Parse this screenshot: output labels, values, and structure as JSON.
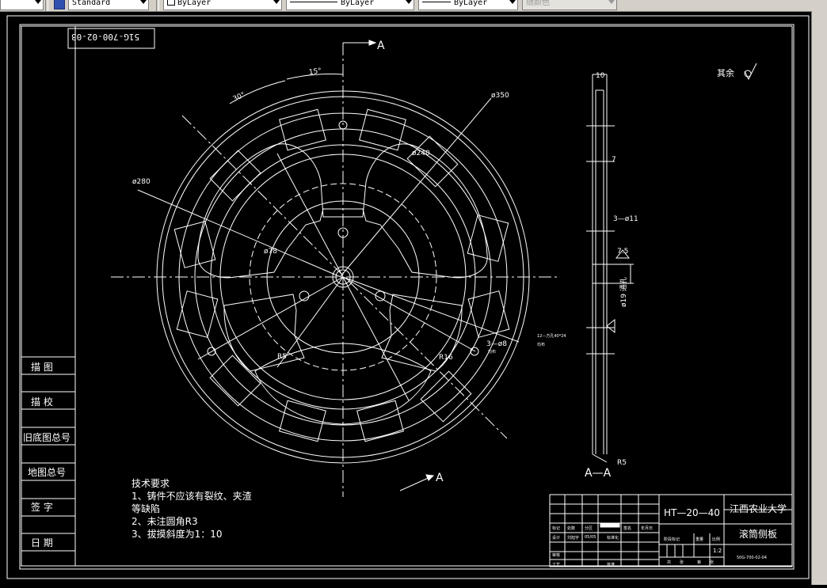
{
  "toolbar": {
    "style_value": "Standard",
    "layer_value": "ByLayer",
    "linetype_value": "ByLayer",
    "lineweight_value": "ByLayer",
    "color_value": "随颜色"
  },
  "drawing": {
    "mirrored_code": "51G-700-02-03",
    "section_label": "A",
    "section_view_label": "A—A",
    "surface_note": "其余",
    "dims": {
      "angle_15": "15°",
      "angle_30": "30°",
      "d350": "ø350",
      "d280": "ø280",
      "d240": "ø240",
      "d78": "ø78",
      "r5": "R5",
      "r16": "R16",
      "holes_3": "3—ø8",
      "slots_12": "12—方孔40*24",
      "slots_sub": "均布",
      "holes_sub": "均布",
      "side_10": "10",
      "side_7": "7",
      "side_holes": "3—ø11",
      "side_75": "7.5",
      "side_d19": "ø19 通孔",
      "side_r5": "R5"
    },
    "left_panel": [
      "描 图",
      "描 校",
      "旧底图总号",
      "地图总号",
      "签 字",
      "日 期"
    ],
    "tech_req": {
      "title": "技术要求",
      "line1": "1、铸件不应该有裂纹、夹渣",
      "line2": "等缺陷",
      "line3": "2、未注圆角R3",
      "line4": "3、拔摸斜度为1：10"
    },
    "title_block": {
      "material": "HT—20—40",
      "school": "江西农业大学",
      "part_name": "滚筒侧板",
      "drawing_no": "50G-700-02-04",
      "scale": "1:2",
      "row_labels": [
        "标记",
        "处数",
        "分区",
        "",
        "签名",
        "年月日"
      ],
      "row2": [
        "设计",
        "刘旭宇",
        "05/05",
        "标准化"
      ],
      "stage_labels": [
        "阶段标记",
        "重量",
        "比例"
      ],
      "bottom": [
        "共",
        "张",
        "第",
        "张"
      ],
      "left_bottom": [
        "审核",
        "工艺",
        "批准"
      ]
    }
  }
}
